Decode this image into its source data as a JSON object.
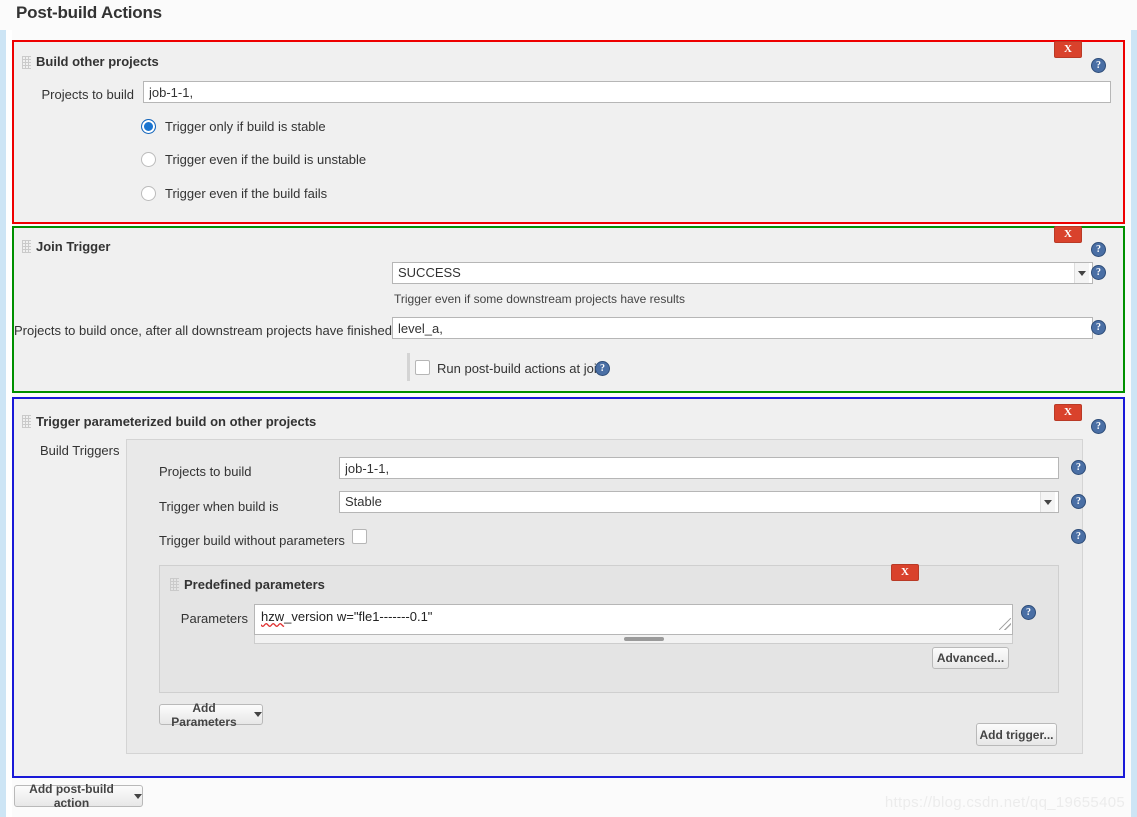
{
  "page": {
    "title": "Post-build Actions",
    "watermark": "https://blog.csdn.net/qq_19655405",
    "delete_label": "X",
    "help_label": "?"
  },
  "colors": {
    "section1_border": "#ee0000",
    "section2_border": "#009000",
    "section3_border": "#1919d8",
    "delete_button": "#d9422c",
    "help_icon": "#4a6fa5",
    "radio_selected": "#1b75d0",
    "page_background": "#fbfbfb",
    "panel_background": "#f0f0f0",
    "left_rail": "#cde5f5"
  },
  "sections": {
    "build_other_projects": {
      "title": "Build other projects",
      "projects_label": "Projects to build",
      "projects_value": "job-1-1,",
      "radios": [
        {
          "label": "Trigger only if build is stable",
          "checked": true
        },
        {
          "label": "Trigger even if the build is unstable",
          "checked": false
        },
        {
          "label": "Trigger even if the build fails",
          "checked": false
        }
      ]
    },
    "join_trigger": {
      "title": "Join Trigger",
      "result_select_value": "SUCCESS",
      "result_hint": "Trigger even if some downstream projects have results",
      "projects_label": "Projects to build once, after all downstream projects have finished",
      "projects_value": "level_a,",
      "run_postbuild_label": "Run post-build actions at join",
      "run_postbuild_checked": false
    },
    "trigger_parameterized": {
      "title": "Trigger parameterized build on other projects",
      "build_triggers_label": "Build Triggers",
      "projects_label": "Projects to build",
      "projects_value": "job-1-1,",
      "trigger_when_label": "Trigger when build is",
      "trigger_when_value": "Stable",
      "without_params_label": "Trigger build without parameters",
      "without_params_checked": false,
      "predefined": {
        "title": "Predefined parameters",
        "parameters_label": "Parameters",
        "parameters_value": "hzw_version w=\"fle1-------0.1\"",
        "parameters_spell_word": "hzw",
        "parameters_rest": "_version w=\"fle1-------0.1\"",
        "advanced_label": "Advanced..."
      },
      "add_parameters_label": "Add Parameters",
      "add_trigger_label": "Add trigger..."
    }
  },
  "footer": {
    "add_postbuild_action_label": "Add post-build action"
  }
}
